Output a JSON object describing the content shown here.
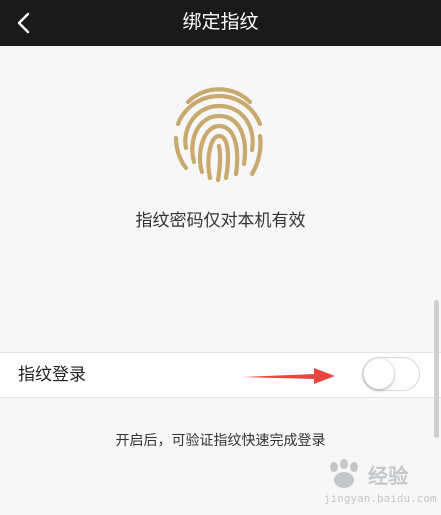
{
  "header": {
    "back_icon": "chevron-left-icon",
    "title": "绑定指纹"
  },
  "main": {
    "fingerprint_icon": "fingerprint-icon",
    "description": "指纹密码仅对本机有效",
    "setting_row": {
      "label": "指纹登录",
      "toggle_on": false
    },
    "hint": "开启后，可验证指纹快速完成登录"
  },
  "watermark": {
    "text": "经验",
    "sub": "jingyan.baidu.com"
  },
  "colors": {
    "nav_bg": "#1a1a1a",
    "fingerprint": "#c8aa6e",
    "arrow": "#e8463f",
    "background": "#f7f7f7"
  }
}
